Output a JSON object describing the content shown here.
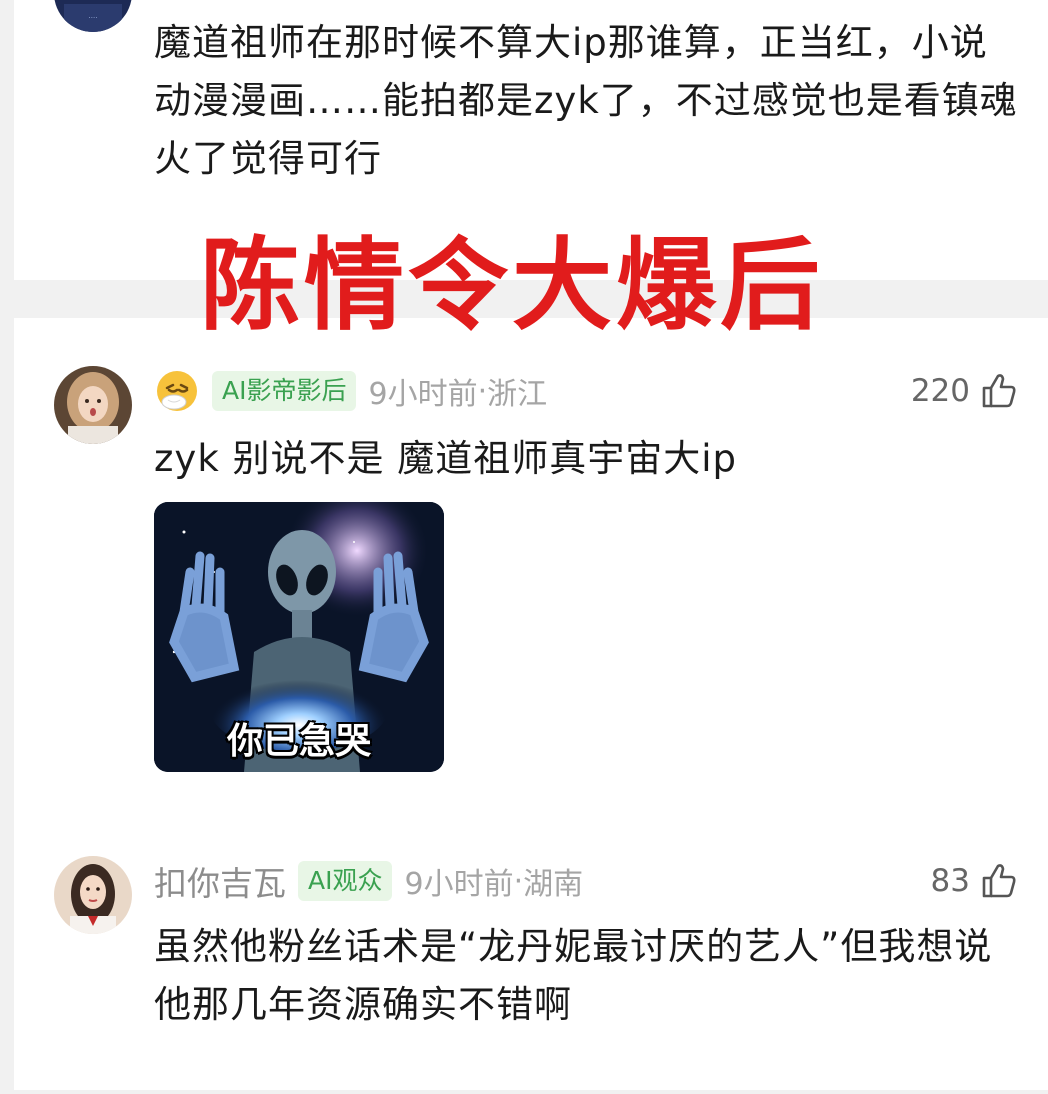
{
  "top_comment": {
    "text": "魔道祖师在那时候不算大ip那谁算，正当红，小说动漫漫画……能拍都是zyk了，不过感觉也是看镇魂火了觉得可行"
  },
  "banner": {
    "text": "陈情令大爆后"
  },
  "comments": [
    {
      "username": "",
      "emoji_badge": "sneezing-face-emoji",
      "badge": "AI影帝影后",
      "time": "9小时前",
      "separator": " · ",
      "location": "浙江",
      "likes": "220",
      "text": "zyk 别说不是 魔道祖师真宇宙大ip",
      "image_caption": "你已急哭"
    },
    {
      "username": "扣你吉瓦",
      "badge": "AI观众",
      "time": "9小时前",
      "separator": " · ",
      "location": "湖南",
      "likes": "83",
      "text": "虽然他粉丝话术是“龙丹妮最讨厌的艺人”但我想说他那几年资源确实不错啊"
    }
  ],
  "colors": {
    "banner": "#e11c1c",
    "badge_bg": "#e8f6e6",
    "badge_text": "#3aa150"
  }
}
